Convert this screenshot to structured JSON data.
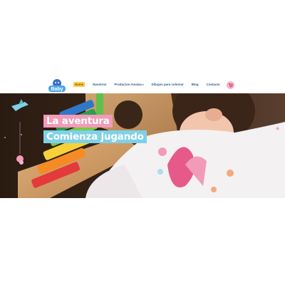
{
  "logo": {
    "icon": "baby-logo-icon",
    "text": "Baby"
  },
  "nav": {
    "items": [
      {
        "label": "Home",
        "active": true
      },
      {
        "label": "Nosotros"
      },
      {
        "label": "Productos Amaisa",
        "has_dropdown": true
      },
      {
        "label": "Dibujos para colorear"
      },
      {
        "label": "Blog"
      },
      {
        "label": "Contacto"
      }
    ]
  },
  "cart": {
    "icon": "cart-icon"
  },
  "hero": {
    "line1": "La aventura",
    "line2": "Comienza jugando",
    "colors": {
      "line1_bg": "#f29bb8",
      "line2_bg": "#7fd1e6"
    }
  }
}
